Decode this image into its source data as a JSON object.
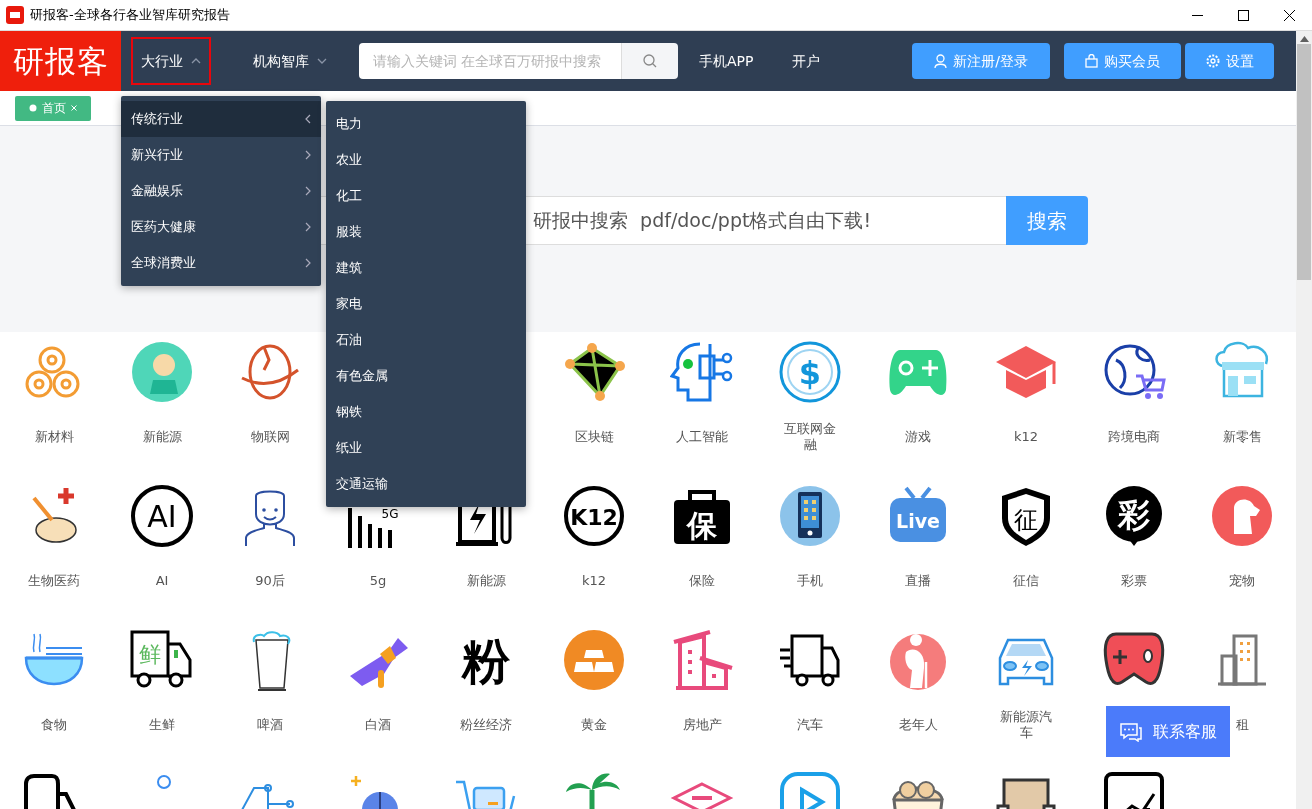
{
  "window": {
    "title": "研报客-全球各行各业智库研究报告"
  },
  "navbar": {
    "logo": "研报客",
    "menus": [
      {
        "label": "大行业",
        "expanded": true
      },
      {
        "label": "机构智库",
        "expanded": false
      }
    ],
    "search": {
      "placeholder": "请输入关键词 在全球百万研报中搜索"
    },
    "links": [
      "手机APP",
      "开户"
    ],
    "buttons": [
      {
        "label": "新注册/登录",
        "kind": "user"
      },
      {
        "label": "购买会员",
        "kind": "bag"
      },
      {
        "label": "设置",
        "kind": "gear"
      }
    ]
  },
  "tabs": [
    {
      "label": "首页",
      "selected": true
    }
  ],
  "hero_search": {
    "value": "研报中搜索  pdf/doc/ppt格式自由下载!",
    "button": "搜索"
  },
  "topics": [
    {
      "items": [
        {
          "label": "新材料"
        },
        {
          "label": "新能源"
        },
        {
          "label": "物联网"
        }
      ],
      "items_right": [
        {
          "label": "区块链"
        },
        {
          "label": "人工智能"
        },
        {
          "label": "互联网金融",
          "glyph": "$"
        },
        {
          "label": "游戏"
        },
        {
          "label": "k12"
        },
        {
          "label": "跨境电商"
        },
        {
          "label": "新零售"
        }
      ]
    },
    {
      "items": [
        {
          "label": "生物医药"
        },
        {
          "label": "AI",
          "glyph": "AI"
        },
        {
          "label": "90后"
        },
        {
          "label": "5g",
          "glyph": "5G"
        },
        {
          "label": "新能源"
        },
        {
          "label": "k12",
          "glyph": "K12"
        },
        {
          "label": "保险",
          "glyph": "保"
        },
        {
          "label": "手机"
        },
        {
          "label": "直播",
          "glyph": "Live"
        },
        {
          "label": "征信",
          "glyph": "征"
        },
        {
          "label": "彩票",
          "glyph": "彩"
        },
        {
          "label": "宠物"
        }
      ]
    },
    {
      "items": [
        {
          "kind": "labeled",
          "label": "食物"
        },
        {
          "kind": "labeled",
          "label": "生鲜",
          "glyph": "鲜"
        },
        {
          "kind": "labeled",
          "label": "啤酒"
        },
        {
          "kind": "labeled",
          "label": "白酒"
        },
        {
          "kind": "labeled",
          "label": "粉丝经济",
          "glyph": "粉"
        },
        {
          "kind": "labeled",
          "label": "黄金"
        },
        {
          "kind": "labeled",
          "label": "房地产"
        },
        {
          "kind": "labeled",
          "label": "汽车"
        },
        {
          "kind": "labeled",
          "label": "老年人"
        },
        {
          "kind": "labeled",
          "label": "新能源汽车"
        },
        {
          "kind": "icon_only"
        },
        {
          "kind": "labeled",
          "label": "租"
        }
      ]
    }
  ],
  "industry_menu": {
    "items": [
      {
        "label": "传统行业",
        "selected": true
      },
      {
        "label": "新兴行业",
        "selected": false
      },
      {
        "label": "金融娱乐",
        "selected": false
      },
      {
        "label": "医药大健康",
        "selected": false
      },
      {
        "label": "全球消费业",
        "selected": false
      }
    ],
    "submenu": [
      "电力",
      "农业",
      "化工",
      "服装",
      "建筑",
      "家电",
      "石油",
      "有色金属",
      "钢铁",
      "纸业",
      "交通运输"
    ]
  },
  "contact_button": {
    "label": "联系客服"
  }
}
